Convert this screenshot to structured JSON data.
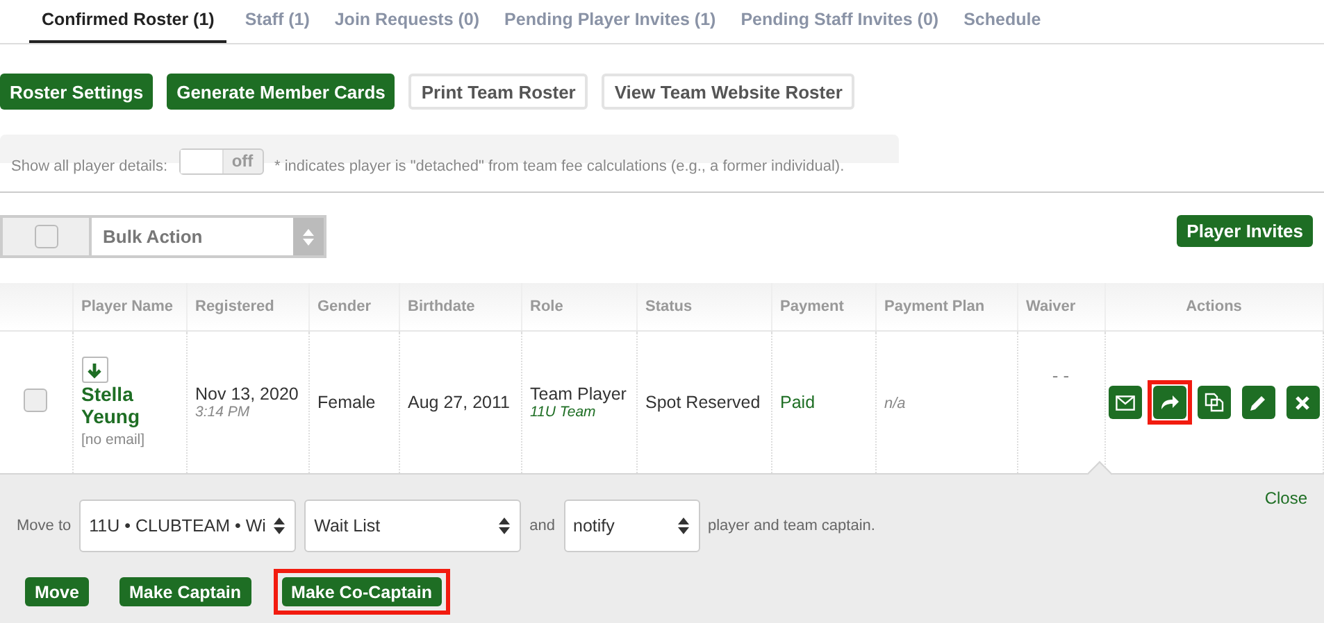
{
  "tabs": [
    {
      "label": "Confirmed Roster (1)",
      "selected": true
    },
    {
      "label": "Staff (1)",
      "selected": false
    },
    {
      "label": "Join Requests (0)",
      "selected": false
    },
    {
      "label": "Pending Player Invites (1)",
      "selected": false
    },
    {
      "label": "Pending Staff Invites (0)",
      "selected": false
    },
    {
      "label": "Schedule",
      "selected": false
    }
  ],
  "toolbar_buttons": [
    {
      "label": "Roster Settings",
      "kind": "primary"
    },
    {
      "label": "Generate Member Cards",
      "kind": "primary"
    },
    {
      "label": "Print Team Roster",
      "kind": "secondary"
    },
    {
      "label": "View Team Website Roster",
      "kind": "secondary"
    }
  ],
  "details": {
    "label": "Show all player details:",
    "toggle": {
      "label": "off",
      "on": false
    },
    "note": "* indicates player is \"detached\" from team fee calculations (e.g., a former individual)."
  },
  "bulk": {
    "checked": false,
    "select": "Bulk Action"
  },
  "player_invites_button": "Player Invites",
  "table": {
    "columns": [
      "",
      "Player Name",
      "Registered",
      "Gender",
      "Birthdate",
      "Role",
      "Status",
      "Payment",
      "Payment Plan",
      "Waiver",
      "Actions"
    ],
    "rows": [
      {
        "checked": false,
        "name": "Stella Yeung",
        "email": "[no email]",
        "registered": "Nov 13, 2020",
        "registered_time": "3:14 PM",
        "gender": "Female",
        "birthdate": "Aug 27, 2011",
        "role": "Team Player",
        "team": "11U Team",
        "status": "Spot Reserved",
        "payment": "Paid",
        "payment_plan": "n/a",
        "waiver": "- -",
        "actions": [
          {
            "kind": "email",
            "highlighted": false
          },
          {
            "kind": "move",
            "highlighted": true
          },
          {
            "kind": "copy",
            "highlighted": false
          },
          {
            "kind": "edit",
            "highlighted": false
          },
          {
            "kind": "delete",
            "highlighted": false
          }
        ]
      }
    ]
  },
  "move_panel": {
    "label": "Move to",
    "selects": [
      "11U • CLUBTEAM • Wi",
      "Wait List",
      "notify"
    ],
    "and": "and",
    "suffix": "player and team captain.",
    "close": "Close",
    "buttons": [
      {
        "label": "Move",
        "highlighted": false
      },
      {
        "label": "Make Captain",
        "highlighted": false
      },
      {
        "label": "Make Co-Captain",
        "highlighted": true
      }
    ]
  }
}
